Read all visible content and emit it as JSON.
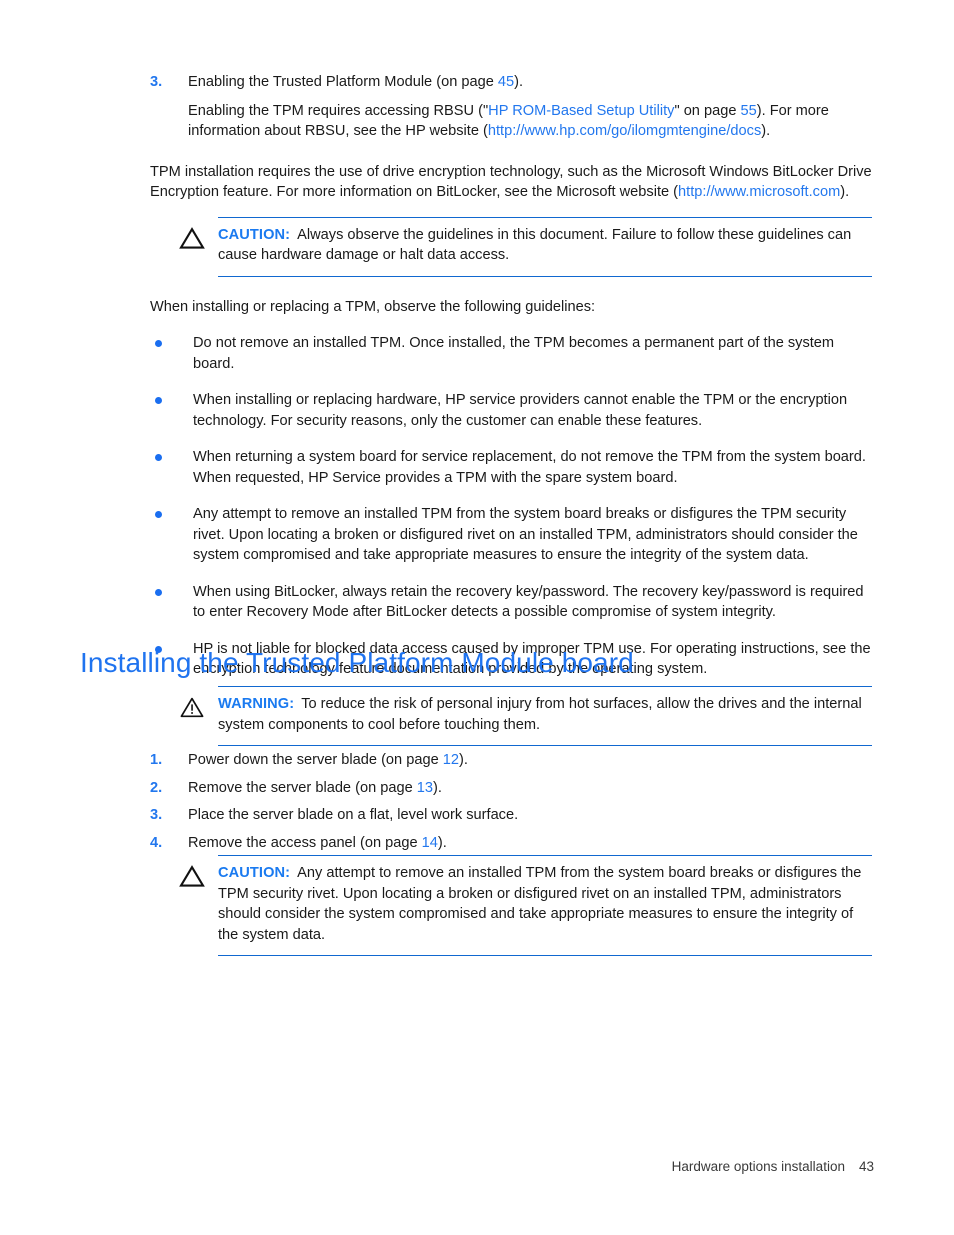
{
  "page": {
    "number": "43",
    "footer_section": "Hardware options installation"
  },
  "top_step": {
    "marker": "3.",
    "text_before": "Enabling the Trusted Platform Module (on page ",
    "page_link": "45",
    "text_after": ")."
  },
  "top_subpara": {
    "part1": "Enabling the TPM requires accessing RBSU (\"",
    "link1": "HP ROM-Based Setup Utility",
    "part2": "\" on page ",
    "link2": "55",
    "part3": "). For more information about RBSU, see the HP website (",
    "link3": "http://www.hp.com/go/ilomgmtengine/docs",
    "part4": ")."
  },
  "tpm_para": {
    "part1": "TPM installation requires the use of drive encryption technology, such as the Microsoft Windows BitLocker Drive Encryption feature. For more information on BitLocker, see the Microsoft website (",
    "link1": "http://www.microsoft.com",
    "part2": ")."
  },
  "caution1": {
    "icon": "caution-triangle-icon",
    "label": "CAUTION:",
    "text": "Always observe the guidelines in this document. Failure to follow these guidelines can cause hardware damage or halt data access."
  },
  "guidelines_intro": "When installing or replacing a TPM, observe the following guidelines:",
  "guidelines": [
    "Do not remove an installed TPM. Once installed, the TPM becomes a permanent part of the system board.",
    "When installing or replacing hardware, HP service providers cannot enable the TPM or the encryption technology. For security reasons, only the customer can enable these features.",
    "When returning a system board for service replacement, do not remove the TPM from the system board. When requested, HP Service provides a TPM with the spare system board.",
    "Any attempt to remove an installed TPM from the system board breaks or disfigures the TPM security rivet. Upon locating a broken or disfigured rivet on an installed TPM, administrators should consider the system compromised and take appropriate measures to ensure the integrity of the system data.",
    "When using BitLocker, always retain the recovery key/password. The recovery key/password is required to enter Recovery Mode after BitLocker detects a possible compromise of system integrity.",
    "HP is not liable for blocked data access caused by improper TPM use. For operating instructions, see the encryption technology feature documentation provided by the operating system."
  ],
  "heading": "Installing the Trusted Platform Module board",
  "warning1": {
    "icon": "warning-triangle-exclamation-icon",
    "label": "WARNING:",
    "text": "To reduce the risk of personal injury from hot surfaces, allow the drives and the internal system components to cool before touching them."
  },
  "steps": [
    {
      "marker": "1.",
      "before": "Power down the server blade (on page ",
      "page_link": "12",
      "after": ")."
    },
    {
      "marker": "2.",
      "before": "Remove the server blade (on page ",
      "page_link": "13",
      "after": ")."
    },
    {
      "marker": "3.",
      "before": "Place the server blade on a flat, level work surface.",
      "page_link": "",
      "after": ""
    },
    {
      "marker": "4.",
      "before": "Remove the access panel (on page ",
      "page_link": "14",
      "after": ")."
    }
  ],
  "caution2": {
    "icon": "caution-triangle-icon",
    "label": "CAUTION:",
    "text": "Any attempt to remove an installed TPM from the system board breaks or disfigures the TPM security rivet. Upon locating a broken or disfigured rivet on an installed TPM, administrators should consider the system compromised and take appropriate measures to ensure the integrity of the system data."
  },
  "colors": {
    "link": "#2277ee",
    "heading": "#1f73ef",
    "rule": "#1168d0",
    "bullet": "#1a6ef0",
    "admon_label": "#1a7af0",
    "body": "#1a1a1a"
  }
}
